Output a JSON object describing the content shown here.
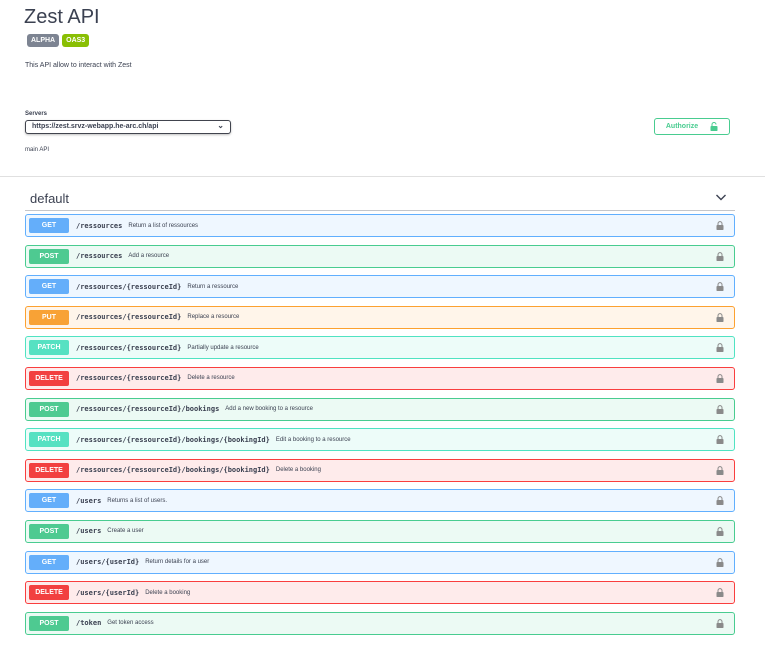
{
  "info": {
    "title": "Zest API",
    "badges": {
      "version": "ALPHA",
      "spec": "OAS3"
    },
    "description": "This API allow to interact with Zest"
  },
  "servers": {
    "label": "Servers",
    "selected": "https://zest.srvz-webapp.he-arc.ch/api",
    "description": "main API"
  },
  "authorize": {
    "label": "Authorize",
    "icon": "unlock-icon",
    "color": "#49cc90"
  },
  "tag": {
    "name": "default",
    "icon": "chevron-down-icon"
  },
  "colors": {
    "GET": "#61affe",
    "POST": "#49cc90",
    "PUT": "#fca130",
    "PATCH": "#50e3c2",
    "DELETE": "#f93e3e"
  },
  "operations": [
    {
      "method": "GET",
      "path": "/ressources",
      "summary": "Return a list of ressources"
    },
    {
      "method": "POST",
      "path": "/ressources",
      "summary": "Add a resource"
    },
    {
      "method": "GET",
      "path": "/ressources/{ressourceId}",
      "summary": "Return a ressource"
    },
    {
      "method": "PUT",
      "path": "/ressources/{ressourceId}",
      "summary": "Replace a resource"
    },
    {
      "method": "PATCH",
      "path": "/ressources/{ressourceId}",
      "summary": "Partially update a resource"
    },
    {
      "method": "DELETE",
      "path": "/ressources/{ressourceId}",
      "summary": "Delete a resource"
    },
    {
      "method": "POST",
      "path": "/ressources/{ressourceId}/bookings",
      "summary": "Add a new booking to a resource"
    },
    {
      "method": "PATCH",
      "path": "/ressources/{ressourceId}/bookings/{bookingId}",
      "summary": "Edit a booking to a resource"
    },
    {
      "method": "DELETE",
      "path": "/ressources/{ressourceId}/bookings/{bookingId}",
      "summary": "Delete a booking"
    },
    {
      "method": "GET",
      "path": "/users",
      "summary": "Returns a list of users."
    },
    {
      "method": "POST",
      "path": "/users",
      "summary": "Create a user"
    },
    {
      "method": "GET",
      "path": "/users/{userId}",
      "summary": "Return details for a user"
    },
    {
      "method": "DELETE",
      "path": "/users/{userId}",
      "summary": "Delete a booking"
    },
    {
      "method": "POST",
      "path": "/token",
      "summary": "Get token access"
    }
  ]
}
